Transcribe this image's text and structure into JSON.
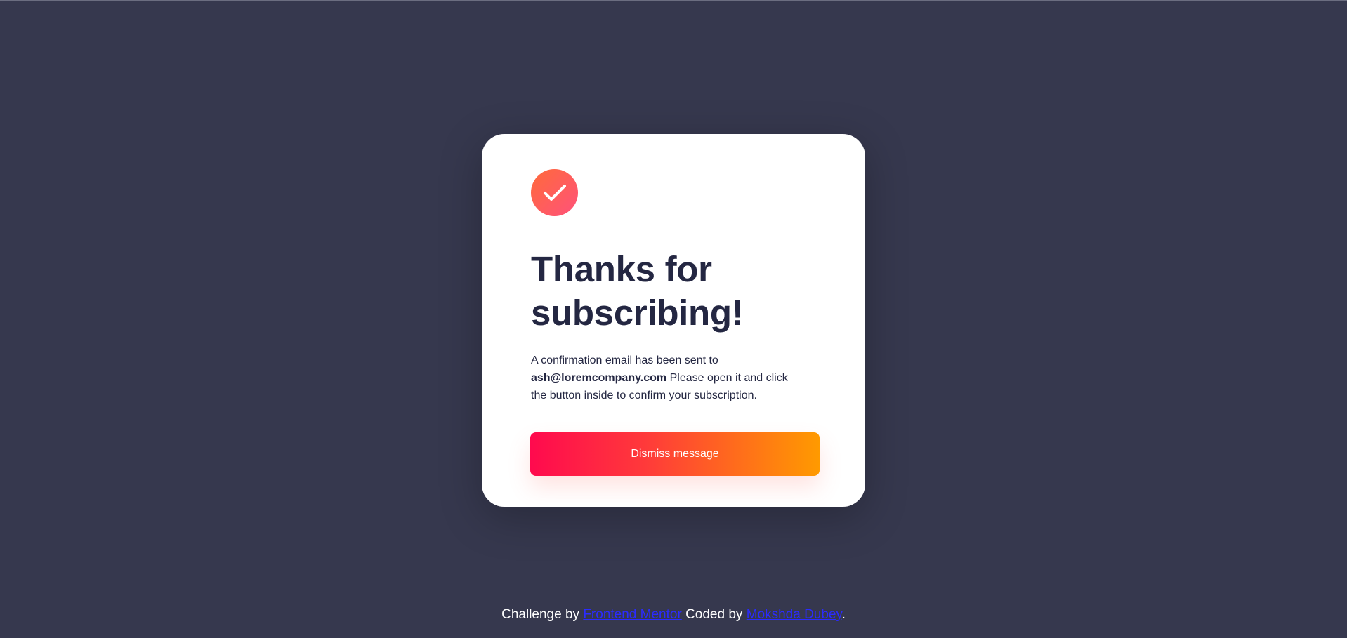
{
  "success_card": {
    "icon": "check-icon",
    "heading": "Thanks for subscribing!",
    "message_before": "A confirmation email has been sent to ",
    "email": "ash@loremcompany.com",
    "message_after": " Please open it and click the button inside to confirm your subscription.",
    "dismiss_label": "Dismiss message"
  },
  "attribution": {
    "challenge_text": "Challenge by ",
    "challenge_link": "Frontend Mentor",
    "coded_text": " Coded by ",
    "author_link": "Mokshda Dubey",
    "end_text": "."
  },
  "colors": {
    "background": "#36384e",
    "card": "#ffffff",
    "heading": "#242742",
    "icon_gradient": [
      "#ff6a3a",
      "#ff527b"
    ],
    "button_gradient": [
      "#ff0a4e",
      "#ff9a00"
    ],
    "link": "#2b2bff"
  }
}
